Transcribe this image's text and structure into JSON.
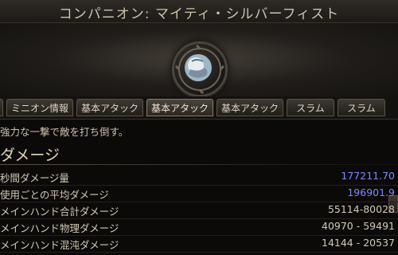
{
  "window": {
    "title": "コンパニオン: マイティ・シルバーフィスト"
  },
  "header": {
    "emblem_icon": "fist-emblem-icon"
  },
  "tabs": [
    {
      "label": "ミニオン情報"
    },
    {
      "label": "基本アタック"
    },
    {
      "label": "基本アタック"
    },
    {
      "label": "基本アタック"
    },
    {
      "label": "スラム"
    },
    {
      "label": "スラム"
    }
  ],
  "ability": {
    "description": "強力な一撃で敵を打ち倒す。",
    "section_title": "ダメージ"
  },
  "stats": [
    {
      "label": "秒間ダメージ量",
      "value": "177211.70",
      "highlight": true
    },
    {
      "label": "使用ごとの平均ダメージ",
      "value": "196901.9",
      "highlight": true
    },
    {
      "label": "メインハンド合計ダメージ",
      "value": "55114-80028",
      "highlight": false
    },
    {
      "label": "メインハンド物理ダメージ",
      "value": "40970 - 59491",
      "highlight": false
    },
    {
      "label": "メインハンド混沌ダメージ",
      "value": "14144 - 20537",
      "highlight": false
    }
  ],
  "colors": {
    "highlight_value": "#7f86ff",
    "text": "#d2c9b6",
    "background": "#0b0a09"
  }
}
